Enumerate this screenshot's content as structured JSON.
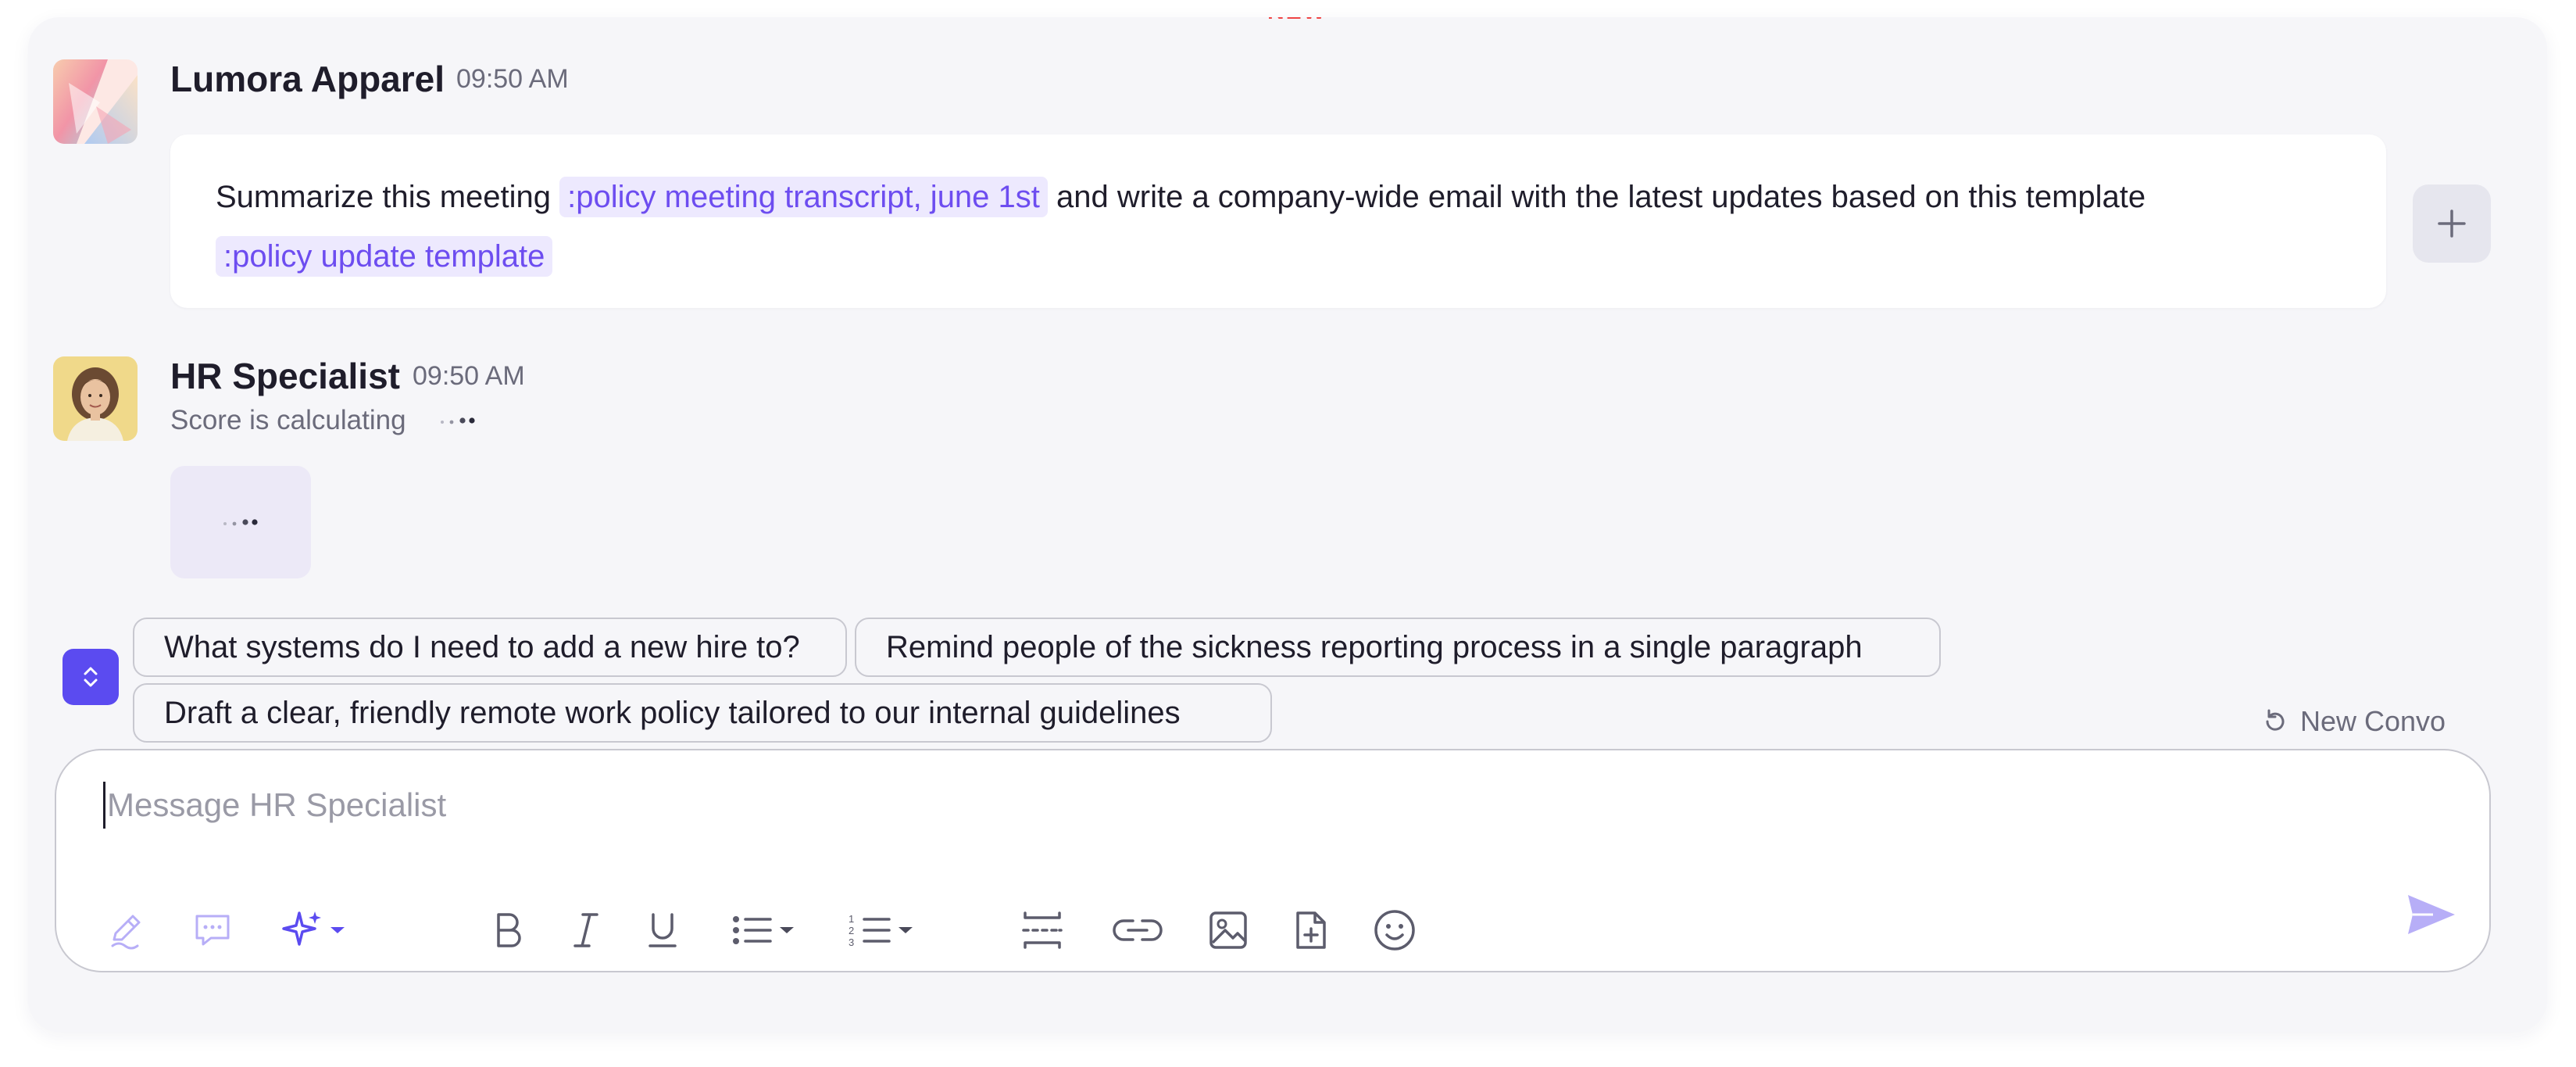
{
  "header": {
    "new_marker": "NEW"
  },
  "messages": [
    {
      "sender": "Lumora Apparel",
      "time": "09:50 AM",
      "text_1": "Summarize this meeting",
      "ref_1": ":policy meeting transcript, june 1st",
      "text_2": "and write a company-wide email with the latest updates based on this template",
      "ref_2": ":policy update template"
    },
    {
      "sender": "HR Specialist",
      "time": "09:50 AM",
      "status": "Score is calculating"
    }
  ],
  "suggestions": [
    "What systems do I need to add a new hire to?",
    "Remind people of the sickness reporting process in a single paragraph",
    "Draft a clear, friendly remote work policy tailored to our internal guidelines"
  ],
  "new_convo_label": "New Convo",
  "composer": {
    "placeholder": "Message HR Specialist",
    "value": ""
  },
  "toolbar": {
    "icons": [
      "rewrite-icon",
      "comment-icon",
      "ai-sparkle-icon",
      "bold-icon",
      "italic-icon",
      "underline-icon",
      "bulleted-list-icon",
      "numbered-list-icon",
      "divider-icon",
      "link-icon",
      "image-icon",
      "file-add-icon",
      "emoji-icon",
      "send-icon"
    ]
  },
  "colors": {
    "accent": "#5b4bf0",
    "reference_bg": "#ede9fe",
    "reference_text": "#6d4df0",
    "panel_bg": "#f6f6f9"
  }
}
